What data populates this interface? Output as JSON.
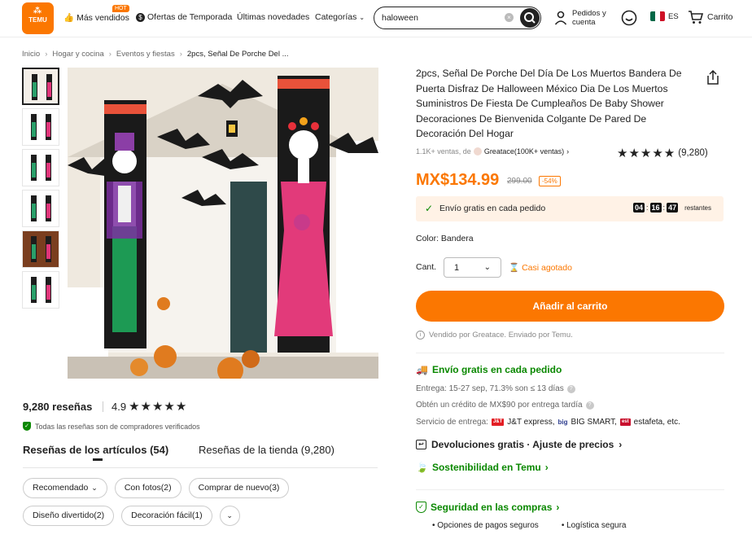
{
  "header": {
    "logo_text": "TEMU",
    "nav": {
      "best_sellers": "Más vendidos",
      "hot_badge": "HOT",
      "season_deals": "Ofertas de Temporada",
      "new_arrivals": "Últimas novedades",
      "categories": "Categorías"
    },
    "search": {
      "value": "haloween"
    },
    "account": {
      "line1": "Pedidos y",
      "line2": "cuenta"
    },
    "language": "ES",
    "cart": "Carrito"
  },
  "breadcrumb": {
    "items": [
      "Inicio",
      "Hogar y cocina",
      "Eventos y fiestas"
    ],
    "current": "2pcs, Señal De Porche Del ..."
  },
  "reviews": {
    "count": "9,280 reseñas",
    "score": "4.9",
    "stars": "★★★★★",
    "verified": "Todas las reseñas son de compradores verificados",
    "tab_items": "Reseñas de los artículos (54)",
    "tab_store": "Reseñas de la tienda (9,280)",
    "filters_row1": [
      "Recomendado",
      "Con fotos(2)",
      "Comprar de nuevo(3)"
    ],
    "filters_row2": [
      "Diseño divertido(2)",
      "Decoración fácil(1)"
    ]
  },
  "product": {
    "title": "2pcs, Señal De Porche Del Día De Los Muertos Bandera De Puerta Disfraz De Halloween México Dia De Los Muertos Suministros De Fiesta De Cumpleaños De Baby Shower Decoraciones De Bienvenida Colgante De Pared De Decoración Del Hogar",
    "sales": "1.1K+ ventas, de",
    "store": "Greatace(100K+ ventas)",
    "stars": "★★★★★",
    "rating_count": "(9,280)",
    "price": "MX$134.99",
    "old_price": "299.00",
    "discount": "-54%",
    "free_ship_banner": "Envío gratis en cada pedido",
    "timer": {
      "h": "04",
      "m": "16",
      "s": "47",
      "label": "restantes"
    },
    "color": "Color: Bandera",
    "qty_label": "Cant.",
    "qty_value": "1",
    "low_stock": "Casi agotado",
    "add_to_cart": "Añadir al carrito",
    "sold_by": "Vendido por Greatace. Enviado por Temu."
  },
  "shipping": {
    "title": "Envío gratis en cada pedido",
    "delivery": "Entrega: 15-27 sep, 71.3% son ≤ 13 días",
    "credit": "Obtén un crédito de MX$90 por entrega tardía",
    "service_label": "Servicio de entrega:",
    "carriers": [
      "J&T express,",
      "BIG SMART,",
      "estafeta, etc."
    ],
    "returns": "Devoluciones gratis · Ajuste de precios",
    "sustainability": "Sostenibilidad en Temu",
    "security": "Seguridad en las compras",
    "security_bullets": [
      "• Opciones de pagos seguros",
      "• Logística segura"
    ]
  },
  "colors": {
    "accent": "#fb7701",
    "green": "#0a8800",
    "text": "#222222"
  }
}
